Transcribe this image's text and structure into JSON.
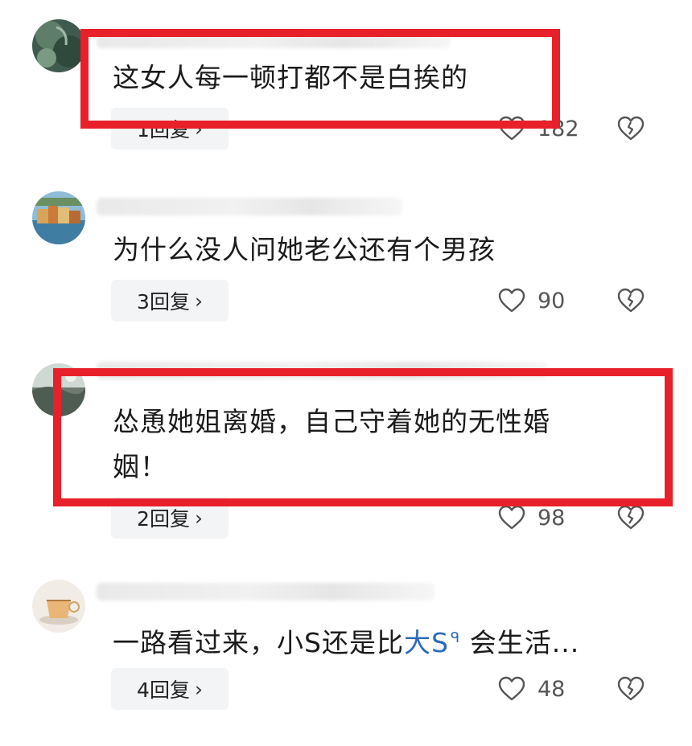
{
  "comments": [
    {
      "text": "这女人每一顿打都不是白挨的",
      "reply_count_label": "1回复",
      "likes": "182"
    },
    {
      "text": "为什么没人问她老公还有个男孩",
      "reply_count_label": "3回复",
      "likes": "90"
    },
    {
      "text_line1": "怂恿她姐离婚，自己守着她的无性婚",
      "text_line2": "姻！",
      "reply_count_label": "2回复",
      "likes": "98"
    },
    {
      "text_before": "一路看过来，小S还是比",
      "mention": "大S",
      "mention_icon": "search-icon",
      "text_after": " 会生活...",
      "reply_count_label": "4回复",
      "likes": "48"
    }
  ],
  "icons": {
    "like": "heart-outline-icon",
    "dislike": "broken-heart-icon",
    "reply_chevron": "chevron-right-icon"
  },
  "colors": {
    "highlight": "#e8202a",
    "mention": "#2d6bb8",
    "reply_bg": "#f3f4f6"
  }
}
